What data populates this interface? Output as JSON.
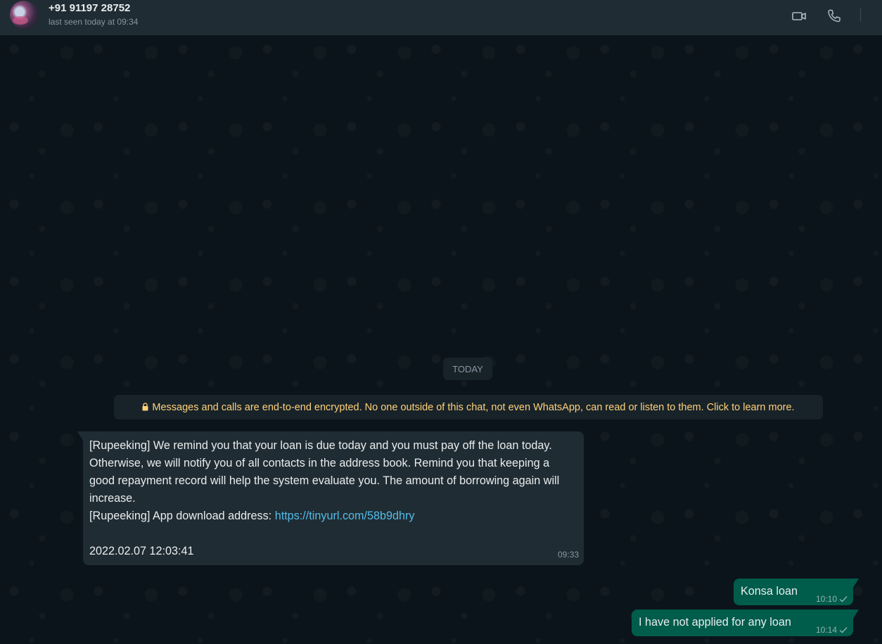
{
  "header": {
    "contact_name": "+91 91197 28752",
    "status": "last seen today at 09:34",
    "icons": [
      "video-call-icon",
      "voice-call-icon"
    ]
  },
  "chat": {
    "date_divider": "TODAY",
    "encryption_notice": "Messages and calls are end-to-end encrypted. No one outside of this chat, not even WhatsApp, can read or listen to them. Click to learn more.",
    "incoming": {
      "lines": [
        "[Rupeeking] We remind you that your loan is due today and you must pay off the loan today.",
        "Otherwise, we will notify you of all contacts in the address book. Remind you that keeping a",
        "good repayment record will help the system evaluate you. The amount of borrowing again will",
        "increase."
      ],
      "download_prefix": "[Rupeeking] App download address: ",
      "link": "https://tinyurl.com/58b9dhry",
      "timestamp_line": "2022.02.07 12:03:41",
      "time": "09:33"
    },
    "outgoing": [
      {
        "text": "Konsa loan",
        "time": "10:10"
      },
      {
        "text": "I have not applied for any loan",
        "time": "10:14"
      }
    ]
  },
  "colors": {
    "header_bg": "#202c33",
    "chat_bg": "#0b141a",
    "incoming_bubble": "#202c33",
    "outgoing_bubble": "#005c4b",
    "notice_text": "#ffd279",
    "link": "#53bdeb"
  }
}
